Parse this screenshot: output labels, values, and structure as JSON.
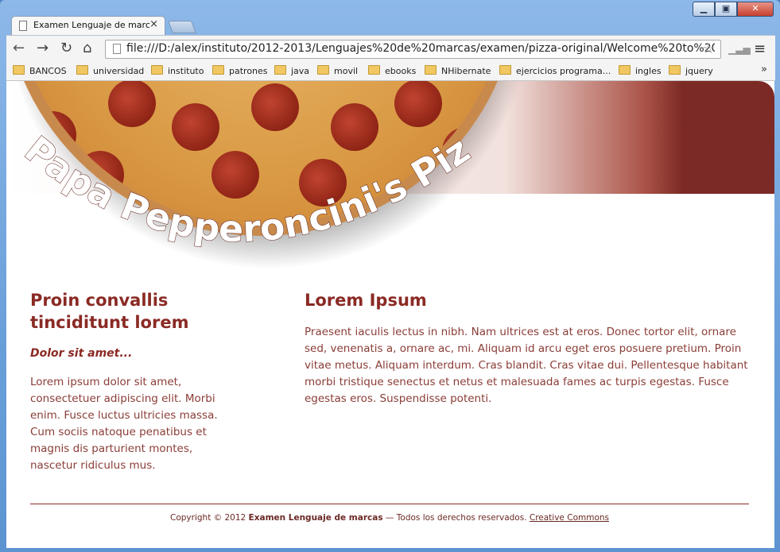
{
  "window": {
    "controls": {
      "minimize": "▁",
      "maximize": "▣",
      "close": "✕"
    }
  },
  "tab": {
    "title": "Examen Lenguaje de marc",
    "close": "×"
  },
  "toolbar": {
    "back": "←",
    "forward": "→",
    "reload": "↻",
    "home": "⌂",
    "url": "file:///D:/alex/instituto/2012-2013/Lenguajes%20de%20marcas/examen/pizza-original/Welcome%20to%20Pa",
    "star": "☆",
    "signal": "▁▃▅",
    "menu": "≡"
  },
  "bookmarks": {
    "items": [
      "BANCOS",
      "universidad",
      "instituto",
      "patrones",
      "java",
      "movil",
      "ebooks",
      "NHibernate",
      "ejercicios programa...",
      "ingles",
      "jquery"
    ],
    "more": "»"
  },
  "banner": {
    "title": "Papa Pepperoncini's Pizza"
  },
  "sidebar": {
    "heading": "Proin convallis tinciditunt lorem",
    "subheading": "Dolor sit amet...",
    "body": "Lorem ipsum dolor sit amet, consectetuer adipiscing elit. Morbi enim. Fusce luctus ultricies massa. Cum sociis natoque penatibus et magnis dis parturient montes, nascetur ridiculus mus."
  },
  "main": {
    "heading": "Lorem Ipsum",
    "body": "Praesent iaculis lectus in nibh. Nam ultrices est at eros. Donec tortor elit, ornare sed, venenatis a, ornare ac, mi. Aliquam id arcu eget eros posuere pretium. Proin vitae metus. Aliquam interdum. Cras blandit. Cras vitae dui. Pellentesque habitant morbi tristique senectus et netus et malesuada fames ac turpis egestas. Fusce egestas eros. Suspendisse potenti."
  },
  "footer": {
    "prefix": "Copyright © 2012",
    "site": "Examen Lenguaje de marcas",
    "suffix": "— Todos los derechos reservados.",
    "link": "Creative Commons"
  }
}
